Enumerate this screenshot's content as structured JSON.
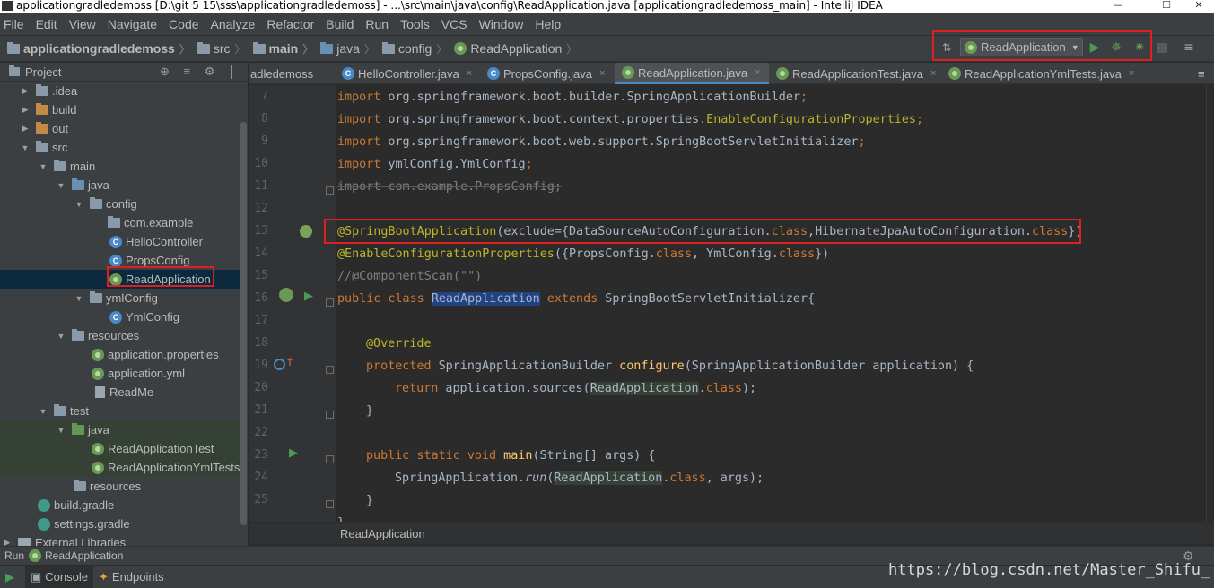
{
  "window": {
    "title": "applicationgradledemoss [D:\\git 5 15\\sss\\applicationgradledemoss] - ...\\src\\main\\java\\config\\ReadApplication.java [applicationgradledemoss_main] - IntelliJ IDEA",
    "minimize": "—",
    "maximize": "☐",
    "close": "✕"
  },
  "menu": [
    "File",
    "Edit",
    "View",
    "Navigate",
    "Code",
    "Analyze",
    "Refactor",
    "Build",
    "Run",
    "Tools",
    "VCS",
    "Window",
    "Help"
  ],
  "breadcrumb": [
    "applicationgradledemoss",
    "src",
    "main",
    "java",
    "config",
    "ReadApplication"
  ],
  "toolbar": {
    "run_config": "ReadApplication",
    "run_glyph": "▶",
    "debug_glyph": "✵",
    "coverage_glyph": "✷",
    "structure_glyph": "≡",
    "build_glyph": "⇅"
  },
  "project_panel": {
    "title": "Project",
    "header_icons": "⊕ ≡ ⚙ │"
  },
  "tree": [
    {
      "label": ".idea",
      "arrow": "▶",
      "icon": "folder"
    },
    {
      "label": "build",
      "arrow": "▶",
      "icon": "folder-orange"
    },
    {
      "label": "out",
      "arrow": "▶",
      "icon": "folder-orange"
    },
    {
      "label": "src",
      "arrow": "▼",
      "icon": "folder"
    },
    {
      "label": "main",
      "arrow": "▼",
      "icon": "folder"
    },
    {
      "label": "java",
      "arrow": "▼",
      "icon": "folder-blue"
    },
    {
      "label": "config",
      "arrow": "▼",
      "icon": "folder"
    },
    {
      "label": "com.example",
      "arrow": "",
      "icon": "folder"
    },
    {
      "label": "HelloController",
      "arrow": "",
      "icon": "class",
      "glyph": "C"
    },
    {
      "label": "PropsConfig",
      "arrow": "",
      "icon": "class",
      "glyph": "C"
    },
    {
      "label": "ReadApplication",
      "arrow": "",
      "icon": "spring-class"
    },
    {
      "label": "ymlConfig",
      "arrow": "▼",
      "icon": "folder"
    },
    {
      "label": "YmlConfig",
      "arrow": "",
      "icon": "class",
      "glyph": "C"
    },
    {
      "label": "resources",
      "arrow": "▼",
      "icon": "folder-res"
    },
    {
      "label": "application.properties",
      "arrow": "",
      "icon": "spring-leaf"
    },
    {
      "label": "application.yml",
      "arrow": "",
      "icon": "spring-leaf"
    },
    {
      "label": "ReadMe",
      "arrow": "",
      "icon": "file"
    },
    {
      "label": "test",
      "arrow": "▼",
      "icon": "folder"
    },
    {
      "label": "java",
      "arrow": "▼",
      "icon": "folder-green"
    },
    {
      "label": "ReadApplicationTest",
      "arrow": "",
      "icon": "spring-class"
    },
    {
      "label": "ReadApplicationYmlTests",
      "arrow": "",
      "icon": "spring-class"
    },
    {
      "label": "resources",
      "arrow": "",
      "icon": "folder-res"
    },
    {
      "label": "build.gradle",
      "arrow": "",
      "icon": "gradle"
    },
    {
      "label": "settings.gradle",
      "arrow": "",
      "icon": "gradle"
    },
    {
      "label": "External Libraries",
      "arrow": "▶",
      "icon": "library"
    }
  ],
  "tabs": [
    {
      "label": "adledemoss",
      "close": ""
    },
    {
      "label": "HelloController.java",
      "close": "×"
    },
    {
      "label": "PropsConfig.java",
      "close": "×"
    },
    {
      "label": "ReadApplication.java",
      "close": "×"
    },
    {
      "label": "ReadApplicationTest.java",
      "close": "×"
    },
    {
      "label": "ReadApplicationYmlTests.java",
      "close": "×"
    }
  ],
  "tab_overflow": "≡",
  "line_numbers": [
    "7",
    "8",
    "9",
    "10",
    "11",
    "12",
    "13",
    "14",
    "15",
    "16",
    "17",
    "18",
    "19",
    "20",
    "21",
    "22",
    "23",
    "24",
    "25"
  ],
  "code": {
    "l7": {
      "kw": "import",
      "rest": " org.springframework.boot.builder.SpringApplicationBuilder",
      "semi": ";"
    },
    "l8": {
      "kw": "import",
      "rest": " org.springframework.boot.context.properties.",
      "ann": "EnableConfigurationProperties",
      "semi": ";"
    },
    "l9": {
      "kw": "import",
      "rest": " org.springframework.boot.web.support.SpringBootServletInitializer",
      "semi": ";"
    },
    "l10": {
      "kw": "import",
      "rest": " ymlConfig.YmlConfig",
      "semi": ";"
    },
    "l11": {
      "text": "import com.example.PropsConfig;"
    },
    "l13": {
      "ann": "@SpringBootApplication",
      "a": "(exclude={DataSourceAutoConfiguration.",
      "k1": "class",
      "b": ",HibernateJpaAutoConfiguration.",
      "k2": "class",
      "c": "})"
    },
    "l14": {
      "ann": "@EnableConfigurationProperties",
      "a": "({PropsConfig.",
      "k1": "class",
      "b": ", YmlConfig.",
      "k2": "class",
      "c": "})"
    },
    "l15": {
      "text": "//@ComponentScan(\"\")"
    },
    "l16": {
      "k1": "public class ",
      "name": "ReadApplication",
      "k2": " extends",
      "rest": " SpringBootServletInitializer{"
    },
    "l18": {
      "ann": "@Override"
    },
    "l19": {
      "k1": "protected",
      "a": " SpringApplicationBuilder ",
      "m": "configure",
      "b": "(SpringApplicationBuilder application) {"
    },
    "l20": {
      "k1": "return",
      "a": " application.sources(",
      "ref": "ReadApplication",
      "b": ".",
      "k2": "class",
      "c": ");"
    },
    "l21": {
      "text": "}"
    },
    "l23": {
      "k1": "public static void",
      "m": " main",
      "a": "(String[] args) {"
    },
    "l24": {
      "a": "SpringApplication.",
      "it": "run",
      "b": "(",
      "ref": "ReadApplication",
      "c": ".",
      "k2": "class",
      "d": ", args);"
    },
    "l25": {
      "text": "}"
    },
    "l26": {
      "text": "}"
    }
  },
  "editor_breadcrumb": "ReadApplication",
  "run_bar": {
    "label": "Run",
    "config": "ReadApplication",
    "gear": "⚙"
  },
  "bottom_tabs": [
    {
      "label": "Console",
      "glyph": "▣"
    },
    {
      "label": "Endpoints",
      "glyph": "✦"
    }
  ],
  "bottom_run_glyph": "▶",
  "watermark": "https://blog.csdn.net/Master_Shifu_",
  "colors": {
    "keyword": "#cc7832",
    "annotation": "#bbb529",
    "highlight_box": "#e02020",
    "selection": "#0d293e"
  }
}
